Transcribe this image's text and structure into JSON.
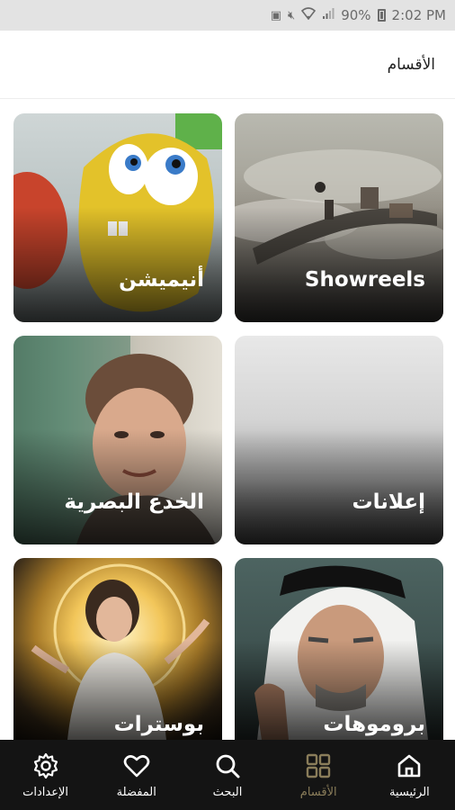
{
  "status_bar": {
    "battery": "90%",
    "time": "2:02 PM"
  },
  "header": {
    "title": "الأقسام"
  },
  "categories": [
    {
      "label": "Showreels"
    },
    {
      "label": "أنيميشن"
    },
    {
      "label": "إعلانات"
    },
    {
      "label": "الخدع البصرية"
    },
    {
      "label": "بروموهات"
    },
    {
      "label": "بوسترات"
    }
  ],
  "nav": {
    "items": [
      {
        "label": "الرئيسية",
        "icon": "home-icon"
      },
      {
        "label": "الأقسام",
        "icon": "grid-icon",
        "active": true
      },
      {
        "label": "البحث",
        "icon": "search-icon"
      },
      {
        "label": "المفضلة",
        "icon": "heart-icon"
      },
      {
        "label": "الإعدادات",
        "icon": "gear-icon"
      }
    ]
  },
  "colors": {
    "nav_background": "#141414",
    "nav_active": "#8a7d5a",
    "status_bar": "#e3e3e3"
  }
}
